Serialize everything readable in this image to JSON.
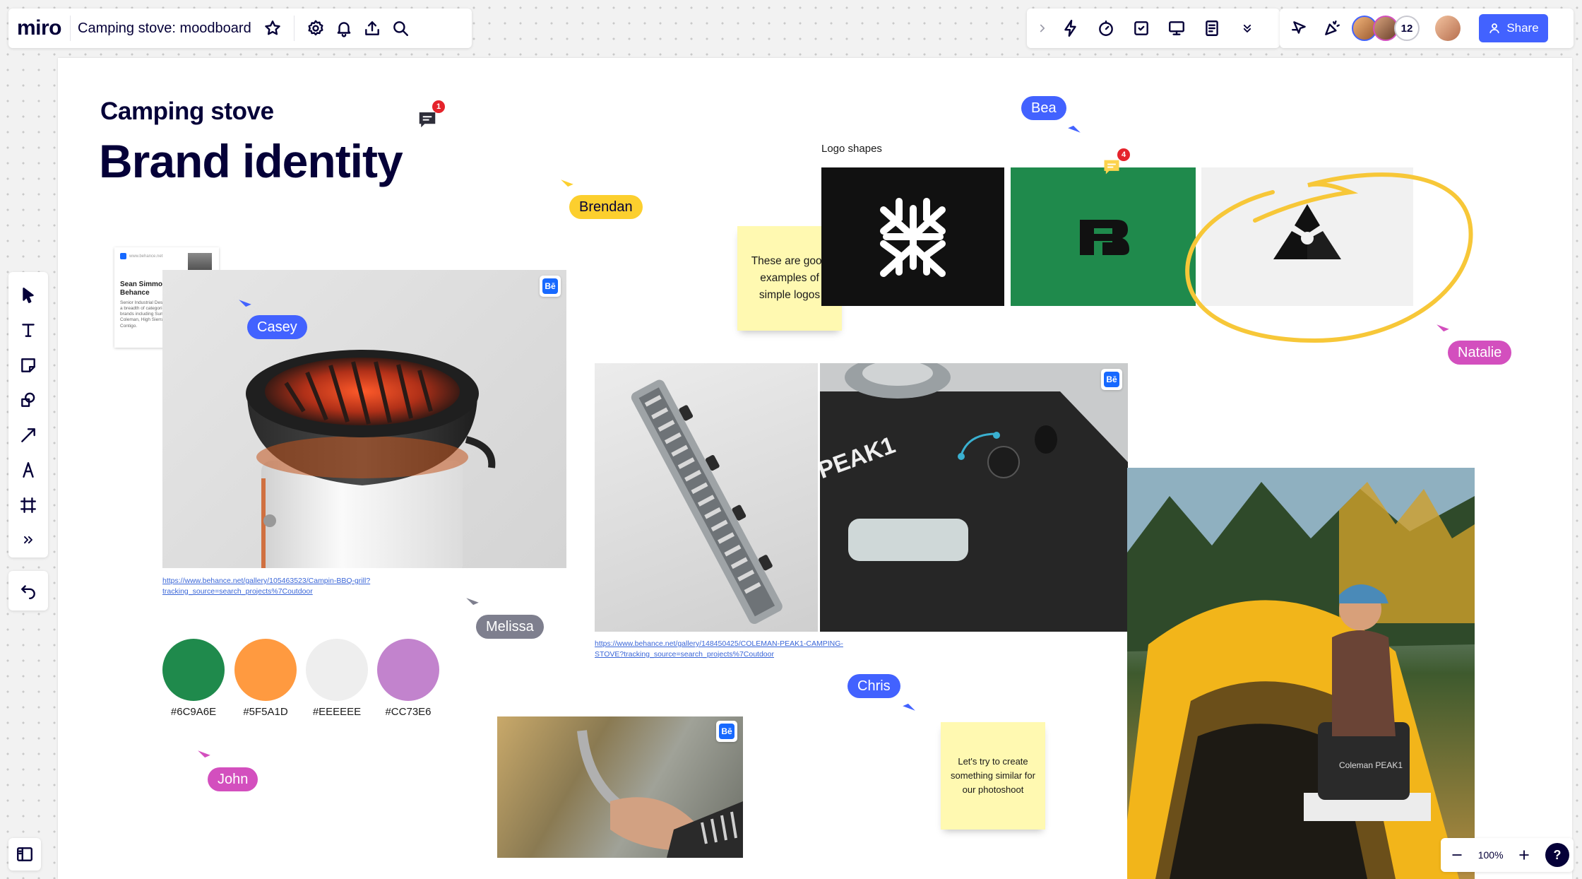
{
  "app": {
    "logo_text": "miro",
    "board_title": "Camping stove: moodboard",
    "share_label": "Share",
    "collaborator_count": "12",
    "zoom_level": "100%",
    "help_label": "?"
  },
  "board": {
    "heading_small": "Camping stove",
    "heading_large": "Brand identity",
    "logo_shapes_label": "Logo shapes",
    "sticky_logos": "These are good examples of simple logos",
    "sticky_photoshoot": "Let's try to create something similar for our photoshoot",
    "link_bbq": "https://www.behance.net/gallery/105463523/Campin-BBQ-grill?tracking_source=search_projects%7Coutdoor",
    "link_peak": "https://www.behance.net/gallery/148450425/COLEMAN-PEAK1-CAMPING-STOVE?tracking_source=search_projects%7Coutdoor",
    "behance_card": {
      "url": "www.behance.net",
      "title": "Sean Simmons on Behance",
      "desc": "Senior Industrial Designer with experience in a breadth of categories. Design for numerous brands including Sunbeam, Oster, Mr. Coffee, Coleman, High Sierra, NUK, Calphalon, Contigo."
    },
    "swatches": [
      {
        "hex": "#1F8A4C",
        "label": "#6C9A6E"
      },
      {
        "hex": "#FF9A40",
        "label": "#5F5A1D"
      },
      {
        "hex": "#EEEEEE",
        "label": "#EEEEEE"
      },
      {
        "hex": "#C283CD",
        "label": "#CC73E6"
      }
    ],
    "comment_counts": {
      "heading": "1",
      "logos": "4"
    },
    "cursors": {
      "bea": "Bea",
      "brendan": "Brendan",
      "casey": "Casey",
      "natalie": "Natalie",
      "melissa": "Melissa",
      "chris": "Chris",
      "john": "John"
    },
    "tent_box_text": "Coleman PEAK1",
    "stove_brand_text": "PEAK1"
  },
  "colors": {
    "accent_blue": "#4262FF",
    "cursor_blue": "#4262FF",
    "cursor_yellow": "#FCCF2E",
    "cursor_pink": "#D34FBE",
    "cursor_gray": "#7E7F8E",
    "logo_green": "#1F8A4C"
  }
}
